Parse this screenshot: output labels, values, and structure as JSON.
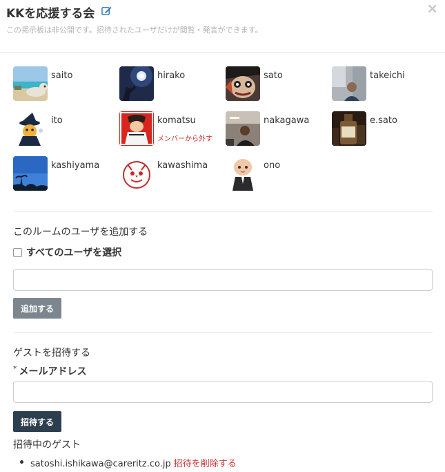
{
  "header": {
    "title": "KKを応援する会",
    "subtitle": "この掲示板は非公開です。招待されたユーザだけが閲覧・発言ができます。",
    "close_label": "×"
  },
  "members": [
    {
      "name": "saito",
      "avatar": "beach-dog"
    },
    {
      "name": "hirako",
      "avatar": "sun-sky"
    },
    {
      "name": "sato",
      "avatar": "manga-face"
    },
    {
      "name": "takeichi",
      "avatar": "office-person"
    },
    {
      "name": "ito",
      "avatar": "cartoon-wizard"
    },
    {
      "name": "komatsu",
      "avatar": "anime-red",
      "remove_label": "メンバーから外す"
    },
    {
      "name": "nakagawa",
      "avatar": "room-person"
    },
    {
      "name": "e.sato",
      "avatar": "bottle"
    },
    {
      "name": "kashiyama",
      "avatar": "blue-sky"
    },
    {
      "name": "kawashima",
      "avatar": "red-stamp"
    },
    {
      "name": "ono",
      "avatar": "baby-suit"
    }
  ],
  "add_users": {
    "title": "このルームのユーザを追加する",
    "select_all_label": "すべてのユーザを選択",
    "input_value": "",
    "button_label": "追加する"
  },
  "invite": {
    "title": "ゲストを招待する",
    "required_mark": "*",
    "email_label": "メールアドレス",
    "email_value": "",
    "button_label": "招待する",
    "guests_title": "招待中のゲスト",
    "guests": [
      {
        "email": "satoshi.ishikawa@careritz.co.jp",
        "delete_label": "招待を削除する"
      }
    ]
  },
  "colors": {
    "primary_dark": "#2d3e4f",
    "secondary_gray": "#7b868e",
    "danger_link": "#c9302c",
    "edit_icon": "#337ab7"
  }
}
